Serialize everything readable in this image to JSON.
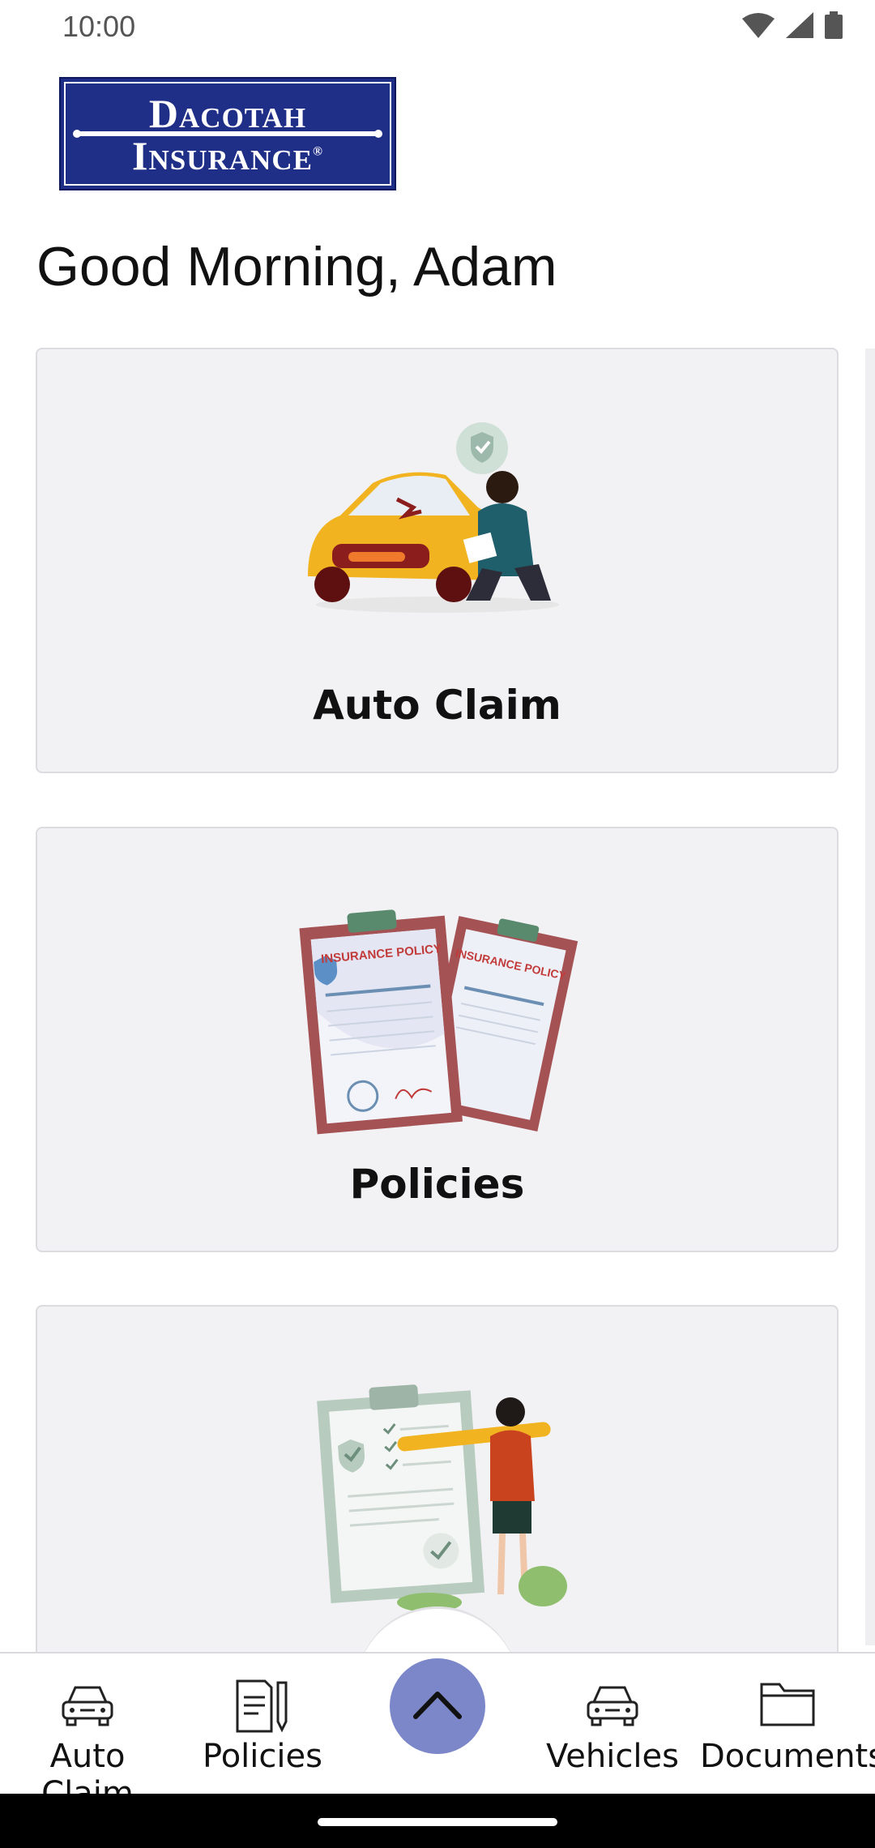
{
  "status_bar": {
    "time": "10:00",
    "icons": [
      "wifi-icon",
      "signal-icon",
      "battery-icon"
    ]
  },
  "logo": {
    "line1": "Dacotah",
    "line2": "Insurance",
    "mark": "®",
    "colors": {
      "background": "#1f2f88",
      "text": "#ffffff"
    }
  },
  "greeting": "Good Morning, Adam",
  "cards": [
    {
      "label": "Auto Claim",
      "illustration": "car-damage-inspection-illustration"
    },
    {
      "label": "Policies",
      "illustration": "insurance-policy-clipboards-illustration",
      "clipboard_text": "INSURANCE POLICY"
    },
    {
      "label": "",
      "illustration": "checklist-with-pencil-illustration"
    }
  ],
  "bottom_nav": {
    "items": [
      {
        "label": "Auto Claim",
        "icon": "car-icon"
      },
      {
        "label": "Policies",
        "icon": "document-pencil-icon"
      },
      {
        "label": "Vehicles",
        "icon": "car-icon"
      },
      {
        "label": "Documents",
        "icon": "folder-icon"
      }
    ],
    "fab_icon": "chevron-up-icon",
    "colors": {
      "fab": "#7b87c8"
    }
  }
}
